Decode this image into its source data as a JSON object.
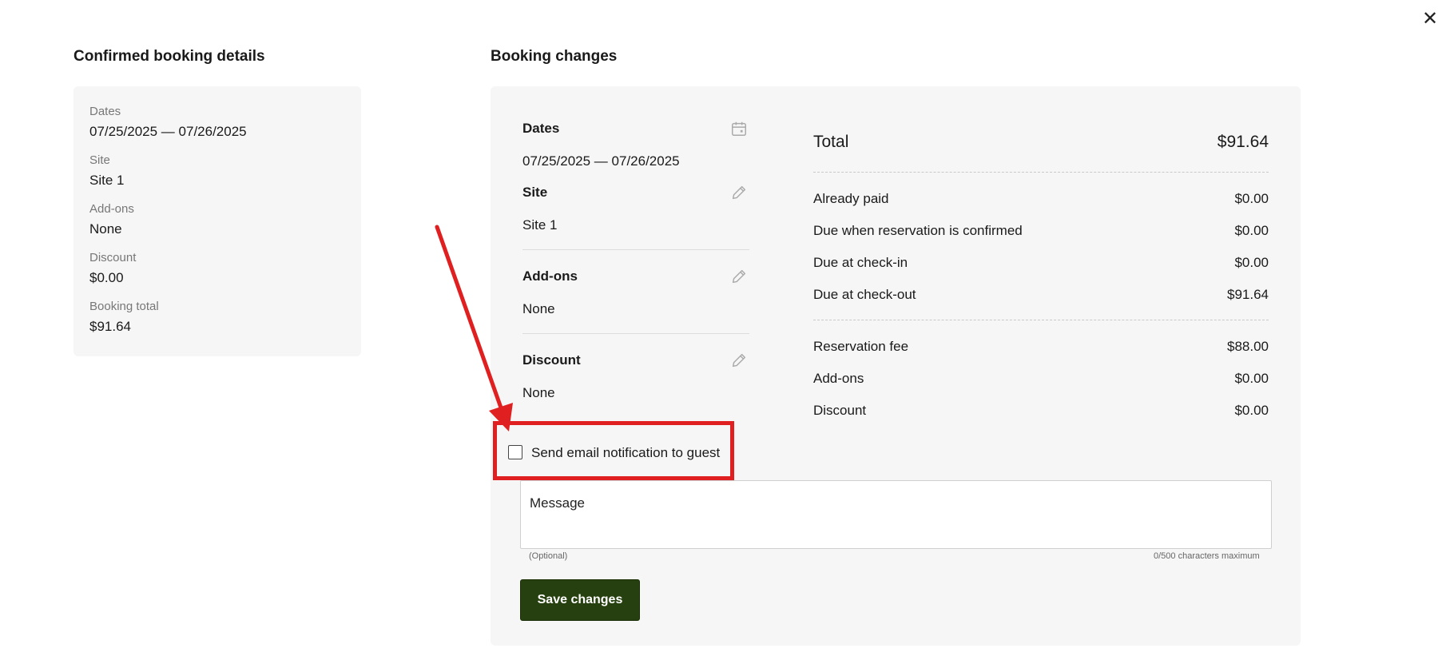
{
  "close_icon_glyph": "✕",
  "left": {
    "title": "Confirmed booking details",
    "dates_label": "Dates",
    "dates_value": "07/25/2025 — 07/26/2025",
    "site_label": "Site",
    "site_value": "Site 1",
    "addons_label": "Add-ons",
    "addons_value": "None",
    "discount_label": "Discount",
    "discount_value": "$0.00",
    "total_label": "Booking total",
    "total_value": "$91.64"
  },
  "right": {
    "title": "Booking changes",
    "dates_head": "Dates",
    "dates_value": "07/25/2025 — 07/26/2025",
    "site_head": "Site",
    "site_value": "Site 1",
    "addons_head": "Add-ons",
    "addons_value": "None",
    "discount_head": "Discount",
    "discount_value": "None",
    "summary": {
      "total_label": "Total",
      "total_value": "$91.64",
      "paid_label": "Already paid",
      "paid_value": "$0.00",
      "due_confirm_label": "Due when reservation is confirmed",
      "due_confirm_value": "$0.00",
      "due_checkin_label": "Due at check-in",
      "due_checkin_value": "$0.00",
      "due_checkout_label": "Due at check-out",
      "due_checkout_value": "$91.64",
      "res_fee_label": "Reservation fee",
      "res_fee_value": "$88.00",
      "addons_label": "Add-ons",
      "addons_value": "$0.00",
      "discount_label": "Discount",
      "discount_value": "$0.00"
    },
    "notify_label": "Send email notification to guest",
    "message_placeholder": "Message",
    "message_hint": "(Optional)",
    "message_counter": "0/500 characters maximum",
    "save_label": "Save changes"
  },
  "annotation_color": "#e02020",
  "accent_color": "#26410f"
}
